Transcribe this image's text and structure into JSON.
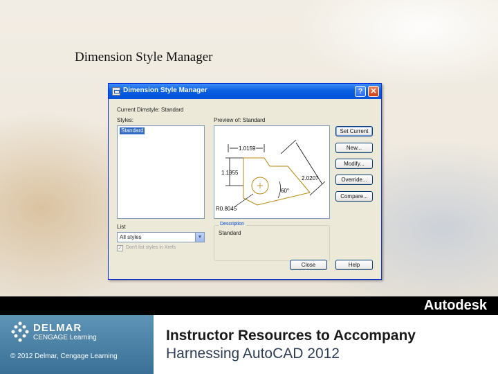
{
  "slide": {
    "title": "Dimension Style Manager",
    "brand": "Autodesk",
    "publisher_line1": "DELMAR",
    "publisher_line2": "CENGAGE Learning",
    "copyright": "© 2012 Delmar, Cengage Learning",
    "headline1": "Instructor Resources to Accompany",
    "headline2": "Harnessing AutoCAD 2012"
  },
  "dialog": {
    "title": "Dimension Style Manager",
    "help_glyph": "?",
    "close_glyph": "✕",
    "current_label": "Current Dimstyle: Standard",
    "styles_label": "Styles:",
    "styles": [
      "Standard"
    ],
    "preview_label": "Preview of: Standard",
    "list_label": "List",
    "list_value": "All styles",
    "checkbox_label": "Don't list styles in Xrefs",
    "description_legend": "Description",
    "description_text": "Standard",
    "buttons": {
      "set_current": "Set Current",
      "new": "New...",
      "modify": "Modify...",
      "override": "Override...",
      "compare": "Compare...",
      "close": "Close",
      "help": "Help"
    },
    "preview_dims": {
      "d1": "1.0159",
      "d2": "1.1955",
      "d3": "2.0207",
      "angle": "60°",
      "radius": "R0.8045"
    }
  },
  "colors": {
    "titlebar": "#0a5fe0",
    "bottom_band": "#4a7fa0",
    "black_band": "#000000",
    "headline1": "#1a1a1a",
    "headline2": "#2d3d55"
  }
}
